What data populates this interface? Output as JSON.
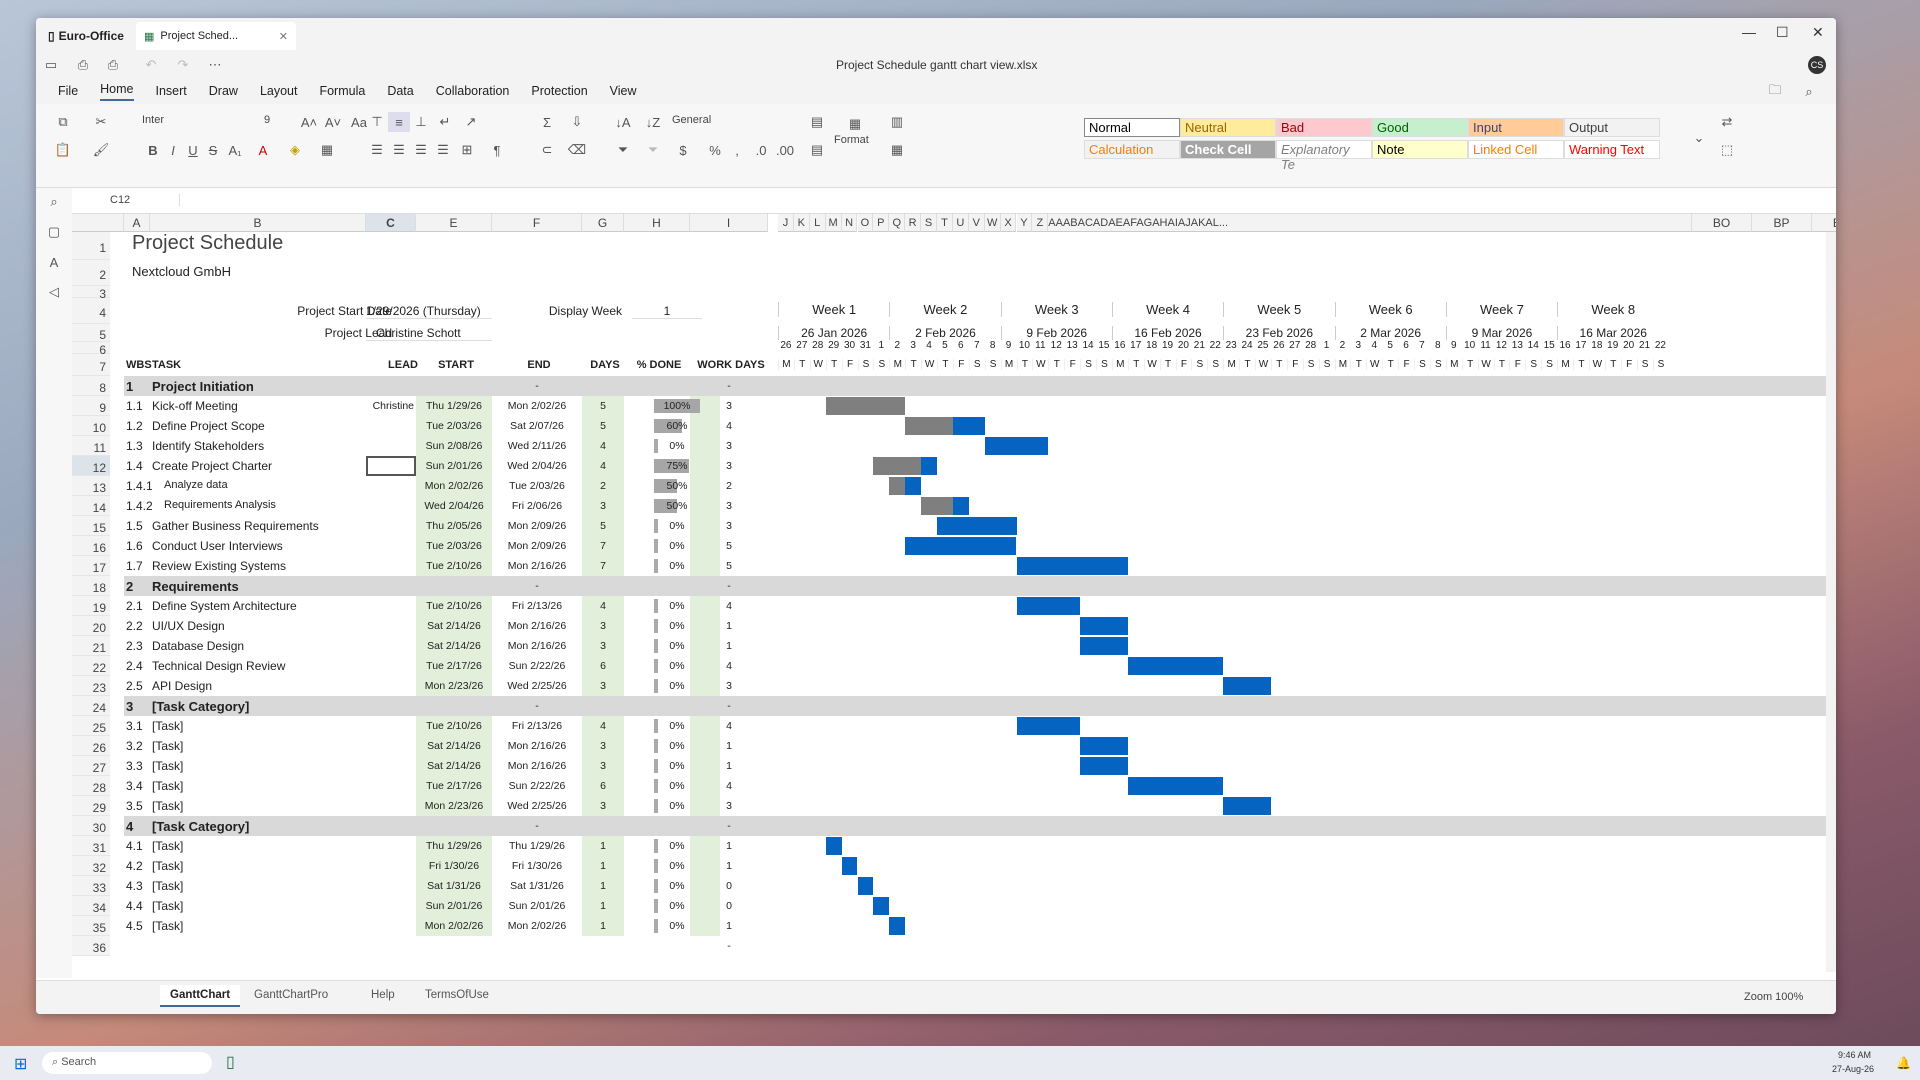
{
  "app": {
    "name": "Euro-Office",
    "doc_tab": "Project Sched...",
    "title": "Project Schedule gantt chart view.xlsx",
    "user_initials": "CS"
  },
  "menu": [
    "File",
    "Home",
    "Insert",
    "Draw",
    "Layout",
    "Formula",
    "Data",
    "Collaboration",
    "Protection",
    "View"
  ],
  "ribbon": {
    "font": "Inter",
    "size": "9",
    "number_format": "General",
    "format_label": "Format",
    "styles": [
      {
        "label": "Normal",
        "bg": "#ffffff",
        "fg": "#000000",
        "border": "#888888"
      },
      {
        "label": "Neutral",
        "bg": "#ffeb9c",
        "fg": "#9c6500"
      },
      {
        "label": "Bad",
        "bg": "#ffc7ce",
        "fg": "#9c0006"
      },
      {
        "label": "Good",
        "bg": "#c6efce",
        "fg": "#006100"
      },
      {
        "label": "Input",
        "bg": "#ffcc99",
        "fg": "#3f3f76"
      },
      {
        "label": "Output",
        "bg": "#f2f2f2",
        "fg": "#3f3f3f"
      },
      {
        "label": "Calculation",
        "bg": "#f2f2f2",
        "fg": "#fa7d00"
      },
      {
        "label": "Check Cell",
        "bg": "#a5a5a5",
        "fg": "#ffffff"
      },
      {
        "label": "Explanatory Te",
        "bg": "#ffffff",
        "fg": "#7f7f7f"
      },
      {
        "label": "Note",
        "bg": "#ffffcc",
        "fg": "#000000"
      },
      {
        "label": "Linked Cell",
        "bg": "#ffffff",
        "fg": "#fa7d00"
      },
      {
        "label": "Warning Text",
        "bg": "#ffffff",
        "fg": "#ff0000"
      }
    ]
  },
  "formula_bar": {
    "cell_ref": "C12",
    "value": ""
  },
  "columns": [
    "A",
    "B",
    "C",
    "E",
    "F",
    "G",
    "H",
    "I",
    "J",
    "K",
    "L",
    "M",
    "N",
    "O",
    "P",
    "Q",
    "R",
    "S",
    "T",
    "U",
    "V",
    "W",
    "X",
    "Y",
    "Z",
    "AAABACADAEAFAGAHAIAJAKAL...",
    "BO",
    "BP",
    "BQ"
  ],
  "sheet": {
    "title": "Project Schedule",
    "company": "Nextcloud GmbH",
    "start_label": "Project Start Date",
    "start_value": "1/29/2026 (Thursday)",
    "lead_label": "Project Lead",
    "lead_value": "Christine Schott",
    "display_week_label": "Display Week",
    "display_week_value": "1",
    "headers": {
      "wbs": "WBS",
      "task": "TASK",
      "lead": "LEAD",
      "start": "START",
      "end": "END",
      "days": "DAYS",
      "done": "% DONE",
      "work": "WORK DAYS"
    },
    "weeks": [
      {
        "name": "Week 1",
        "date": "26 Jan 2026"
      },
      {
        "name": "Week 2",
        "date": "2 Feb 2026"
      },
      {
        "name": "Week 3",
        "date": "9 Feb 2026"
      },
      {
        "name": "Week 4",
        "date": "16 Feb 2026"
      },
      {
        "name": "Week 5",
        "date": "23 Feb 2026"
      },
      {
        "name": "Week 6",
        "date": "2 Mar 2026"
      },
      {
        "name": "Week 7",
        "date": "9 Mar 2026"
      },
      {
        "name": "Week 8",
        "date": "16 Mar 2026"
      }
    ],
    "day_numbers": [
      "26",
      "27",
      "28",
      "29",
      "30",
      "31",
      "1",
      "2",
      "3",
      "4",
      "5",
      "6",
      "7",
      "8",
      "9",
      "10",
      "11",
      "12",
      "13",
      "14",
      "15",
      "16",
      "17",
      "18",
      "19",
      "20",
      "21",
      "22",
      "23",
      "24",
      "25",
      "26",
      "27",
      "28",
      "1",
      "2",
      "3",
      "4",
      "5",
      "6",
      "7",
      "8",
      "9",
      "10",
      "11",
      "12",
      "13",
      "14",
      "15",
      "16",
      "17",
      "18",
      "19",
      "20",
      "21",
      "22"
    ],
    "day_letters": [
      "M",
      "T",
      "W",
      "T",
      "F",
      "S",
      "S"
    ],
    "rows": [
      {
        "n": "8",
        "wbs": "1",
        "task": "Project Initiation",
        "lead": "",
        "start": "",
        "end": "-",
        "days": "",
        "done": "",
        "work": "-",
        "cat": true
      },
      {
        "n": "9",
        "wbs": "1.1",
        "task": "Kick-off Meeting",
        "lead": "Christine",
        "start": "Thu 1/29/26",
        "end": "Mon 2/02/26",
        "days": "5",
        "done": "100%",
        "work": "3",
        "pct": 1.0,
        "s": 3,
        "d": 5
      },
      {
        "n": "10",
        "wbs": "1.2",
        "task": "Define Project Scope",
        "lead": "",
        "start": "Tue 2/03/26",
        "end": "Sat 2/07/26",
        "days": "5",
        "done": "60%",
        "work": "4",
        "pct": 0.6,
        "s": 8,
        "d": 5
      },
      {
        "n": "11",
        "wbs": "1.3",
        "task": "Identify Stakeholders",
        "lead": "",
        "start": "Sun 2/08/26",
        "end": "Wed 2/11/26",
        "days": "4",
        "done": "0%",
        "work": "3",
        "pct": 0,
        "s": 13,
        "d": 4
      },
      {
        "n": "12",
        "wbs": "1.4",
        "task": "Create Project Charter",
        "lead": "",
        "start": "Sun 2/01/26",
        "end": "Wed 2/04/26",
        "days": "4",
        "done": "75%",
        "work": "3",
        "pct": 0.75,
        "s": 6,
        "d": 4
      },
      {
        "n": "13",
        "wbs": "1.4.1",
        "task": "Analyze data",
        "lead": "",
        "start": "Mon 2/02/26",
        "end": "Tue 2/03/26",
        "days": "2",
        "done": "50%",
        "work": "2",
        "pct": 0.5,
        "s": 7,
        "d": 2,
        "sub": true
      },
      {
        "n": "14",
        "wbs": "1.4.2",
        "task": "Requirements Analysis",
        "lead": "",
        "start": "Wed 2/04/26",
        "end": "Fri 2/06/26",
        "days": "3",
        "done": "50%",
        "work": "3",
        "pct": 0.5,
        "s": 9,
        "d": 3,
        "sub": true
      },
      {
        "n": "15",
        "wbs": "1.5",
        "task": "Gather Business Requirements",
        "lead": "",
        "start": "Thu 2/05/26",
        "end": "Mon 2/09/26",
        "days": "5",
        "done": "0%",
        "work": "3",
        "pct": 0,
        "s": 10,
        "d": 5
      },
      {
        "n": "16",
        "wbs": "1.6",
        "task": "Conduct User Interviews",
        "lead": "",
        "start": "Tue 2/03/26",
        "end": "Mon 2/09/26",
        "days": "7",
        "done": "0%",
        "work": "5",
        "pct": 0,
        "s": 8,
        "d": 7
      },
      {
        "n": "17",
        "wbs": "1.7",
        "task": "Review Existing Systems",
        "lead": "",
        "start": "Tue 2/10/26",
        "end": "Mon 2/16/26",
        "days": "7",
        "done": "0%",
        "work": "5",
        "pct": 0,
        "s": 15,
        "d": 7
      },
      {
        "n": "18",
        "wbs": "2",
        "task": "Requirements",
        "lead": "",
        "start": "",
        "end": "-",
        "days": "",
        "done": "",
        "work": "-",
        "cat": true
      },
      {
        "n": "19",
        "wbs": "2.1",
        "task": "Define System Architecture",
        "lead": "",
        "start": "Tue 2/10/26",
        "end": "Fri 2/13/26",
        "days": "4",
        "done": "0%",
        "work": "4",
        "pct": 0,
        "s": 15,
        "d": 4
      },
      {
        "n": "20",
        "wbs": "2.2",
        "task": "UI/UX Design",
        "lead": "",
        "start": "Sat 2/14/26",
        "end": "Mon 2/16/26",
        "days": "3",
        "done": "0%",
        "work": "1",
        "pct": 0,
        "s": 19,
        "d": 3
      },
      {
        "n": "21",
        "wbs": "2.3",
        "task": "Database Design",
        "lead": "",
        "start": "Sat 2/14/26",
        "end": "Mon 2/16/26",
        "days": "3",
        "done": "0%",
        "work": "1",
        "pct": 0,
        "s": 19,
        "d": 3
      },
      {
        "n": "22",
        "wbs": "2.4",
        "task": "Technical Design Review",
        "lead": "",
        "start": "Tue 2/17/26",
        "end": "Sun 2/22/26",
        "days": "6",
        "done": "0%",
        "work": "4",
        "pct": 0,
        "s": 22,
        "d": 6
      },
      {
        "n": "23",
        "wbs": "2.5",
        "task": "API Design",
        "lead": "",
        "start": "Mon 2/23/26",
        "end": "Wed 2/25/26",
        "days": "3",
        "done": "0%",
        "work": "3",
        "pct": 0,
        "s": 28,
        "d": 3
      },
      {
        "n": "24",
        "wbs": "3",
        "task": "[Task Category]",
        "lead": "",
        "start": "",
        "end": "-",
        "days": "",
        "done": "",
        "work": "-",
        "cat": true
      },
      {
        "n": "25",
        "wbs": "3.1",
        "task": "[Task]",
        "lead": "",
        "start": "Tue 2/10/26",
        "end": "Fri 2/13/26",
        "days": "4",
        "done": "0%",
        "work": "4",
        "pct": 0,
        "s": 15,
        "d": 4
      },
      {
        "n": "26",
        "wbs": "3.2",
        "task": "[Task]",
        "lead": "",
        "start": "Sat 2/14/26",
        "end": "Mon 2/16/26",
        "days": "3",
        "done": "0%",
        "work": "1",
        "pct": 0,
        "s": 19,
        "d": 3
      },
      {
        "n": "27",
        "wbs": "3.3",
        "task": "[Task]",
        "lead": "",
        "start": "Sat 2/14/26",
        "end": "Mon 2/16/26",
        "days": "3",
        "done": "0%",
        "work": "1",
        "pct": 0,
        "s": 19,
        "d": 3
      },
      {
        "n": "28",
        "wbs": "3.4",
        "task": "[Task]",
        "lead": "",
        "start": "Tue 2/17/26",
        "end": "Sun 2/22/26",
        "days": "6",
        "done": "0%",
        "work": "4",
        "pct": 0,
        "s": 22,
        "d": 6
      },
      {
        "n": "29",
        "wbs": "3.5",
        "task": "[Task]",
        "lead": "",
        "start": "Mon 2/23/26",
        "end": "Wed 2/25/26",
        "days": "3",
        "done": "0%",
        "work": "3",
        "pct": 0,
        "s": 28,
        "d": 3
      },
      {
        "n": "30",
        "wbs": "4",
        "task": "[Task Category]",
        "lead": "",
        "start": "",
        "end": "-",
        "days": "",
        "done": "",
        "work": "-",
        "cat": true
      },
      {
        "n": "31",
        "wbs": "4.1",
        "task": "[Task]",
        "lead": "",
        "start": "Thu 1/29/26",
        "end": "Thu 1/29/26",
        "days": "1",
        "done": "0%",
        "work": "1",
        "pct": 0,
        "s": 3,
        "d": 1
      },
      {
        "n": "32",
        "wbs": "4.2",
        "task": "[Task]",
        "lead": "",
        "start": "Fri 1/30/26",
        "end": "Fri 1/30/26",
        "days": "1",
        "done": "0%",
        "work": "1",
        "pct": 0,
        "s": 4,
        "d": 1
      },
      {
        "n": "33",
        "wbs": "4.3",
        "task": "[Task]",
        "lead": "",
        "start": "Sat 1/31/26",
        "end": "Sat 1/31/26",
        "days": "1",
        "done": "0%",
        "work": "0",
        "pct": 0,
        "s": 5,
        "d": 1
      },
      {
        "n": "34",
        "wbs": "4.4",
        "task": "[Task]",
        "lead": "",
        "start": "Sun 2/01/26",
        "end": "Sun 2/01/26",
        "days": "1",
        "done": "0%",
        "work": "0",
        "pct": 0,
        "s": 6,
        "d": 1
      },
      {
        "n": "35",
        "wbs": "4.5",
        "task": "[Task]",
        "lead": "",
        "start": "Mon 2/02/26",
        "end": "Mon 2/02/26",
        "days": "1",
        "done": "0%",
        "work": "1",
        "pct": 0,
        "s": 7,
        "d": 1
      },
      {
        "n": "36",
        "wbs": "",
        "task": "",
        "lead": "",
        "start": "",
        "end": "",
        "days": "",
        "done": "",
        "work": "-",
        "blank": true
      }
    ]
  },
  "sheet_tabs": [
    "GanttChart",
    "GanttChartPro",
    "Help",
    "TermsOfUse"
  ],
  "zoom": "Zoom 100%",
  "taskbar": {
    "search": "Search",
    "time": "9:46 AM",
    "date": "27-Aug-26"
  },
  "colors": {
    "bar_blue": "#0563c1",
    "bar_gray": "#7f7f7f",
    "cat_bg": "#d9d9d9",
    "start_bg": "#e2efda",
    "done_bg": "#e2efda"
  }
}
